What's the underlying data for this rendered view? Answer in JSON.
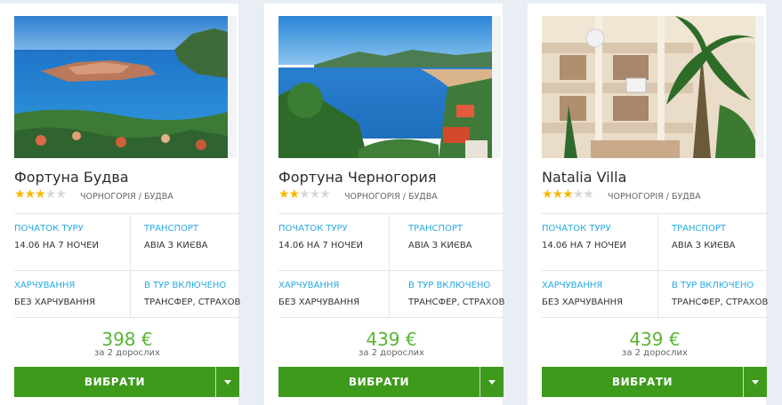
{
  "tours": [
    {
      "title": "Фортуна Будва",
      "stars": 3,
      "location": "Чорногорія / Будва",
      "start_label": "Початок туру",
      "start_value": "14.06 на 7 ночей",
      "transport_label": "Транспорт",
      "transport_value": "Авіа з Києва",
      "meals_label": "Харчування",
      "meals_value": "Без харчування",
      "included_label": "В тур включено",
      "included_value": "Трансфер, страхов...",
      "price": "398 €",
      "persons": "за 2 дорослих",
      "button": "Вибрати"
    },
    {
      "title": "Фортуна Черногория",
      "stars": 2,
      "location": "Чорногорія / Будва",
      "start_label": "Початок туру",
      "start_value": "14.06 на 7 ночей",
      "transport_label": "Транспорт",
      "transport_value": "Авіа з Києва",
      "meals_label": "Харчування",
      "meals_value": "Без харчування",
      "included_label": "В тур включено",
      "included_value": "Трансфер, страхов...",
      "price": "439 €",
      "persons": "за 2 дорослих",
      "button": "Вибрати"
    },
    {
      "title": "Natalia Villa",
      "stars": 3,
      "location": "Чорногорія / Будва",
      "start_label": "Початок туру",
      "start_value": "14.06 на 7 ночей",
      "transport_label": "Транспорт",
      "transport_value": "Авіа з Києва",
      "meals_label": "Харчування",
      "meals_value": "Без харчування",
      "included_label": "В тур включено",
      "included_value": "Трансфер, страхов...",
      "price": "439 €",
      "persons": "за 2 дорослих",
      "button": "Вибрати"
    }
  ],
  "colors": {
    "accent_green": "#3d9a1b",
    "price_green": "#58b535",
    "label_blue": "#27a9e1",
    "star_gold": "#f5b800"
  },
  "icons": {
    "dropdown": "caret-down-icon",
    "star": "star-icon"
  }
}
